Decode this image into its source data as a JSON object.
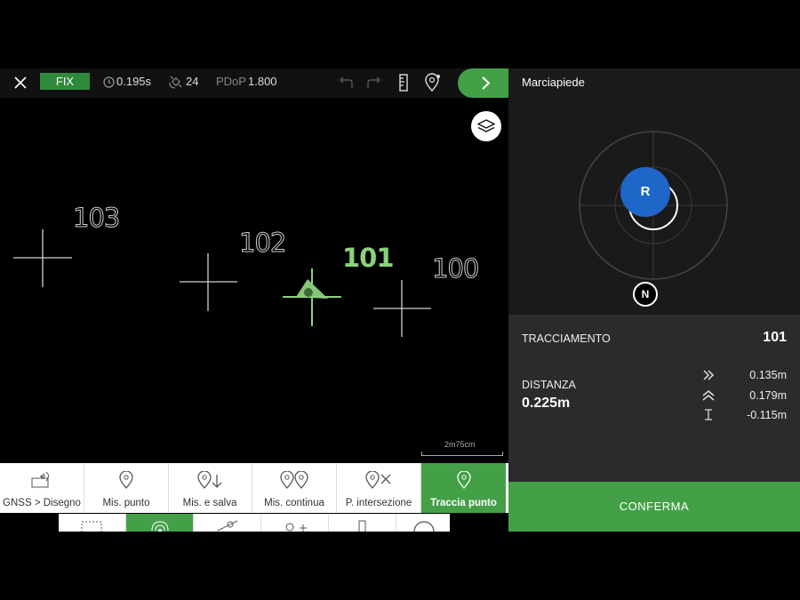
{
  "topbar": {
    "fix_status": "FIX",
    "latency": "0.195s",
    "satellites": "24",
    "pdop_label": "PDoP",
    "pdop_value": "1.800"
  },
  "map": {
    "points": [
      {
        "id": "103",
        "active": false
      },
      {
        "id": "102",
        "active": false
      },
      {
        "id": "101",
        "active": true
      },
      {
        "id": "100",
        "active": false
      }
    ],
    "scale_label": "2m75cm"
  },
  "tabs": [
    {
      "label": "GNSS > Disegno",
      "active": false,
      "icon": "gnss-draw-icon"
    },
    {
      "label": "Mis. punto",
      "active": false,
      "icon": "pin-icon"
    },
    {
      "label": "Mis. e salva",
      "active": false,
      "icon": "pin-save-icon"
    },
    {
      "label": "Mis. continua",
      "active": false,
      "icon": "pin-continuous-icon"
    },
    {
      "label": "P. intersezione",
      "active": false,
      "icon": "pin-intersection-icon"
    },
    {
      "label": "Traccia punto",
      "active": true,
      "icon": "pin-stakeout-icon"
    }
  ],
  "panel": {
    "title": "Marciapiede",
    "rover_label": "R",
    "north_label": "N",
    "stakeout_label": "TRACCIAMENTO",
    "stakeout_point": "101",
    "distance_label": "DISTANZA",
    "distance_value": "0.225m",
    "offsets": {
      "east": "0.135m",
      "north": "0.179m",
      "height": "-0.115m"
    },
    "confirm_label": "CONFERMA"
  },
  "colors": {
    "accent": "#43a047",
    "fix": "#2e8a3a",
    "active_point": "#8bd17c",
    "rover": "#1e66c8"
  }
}
